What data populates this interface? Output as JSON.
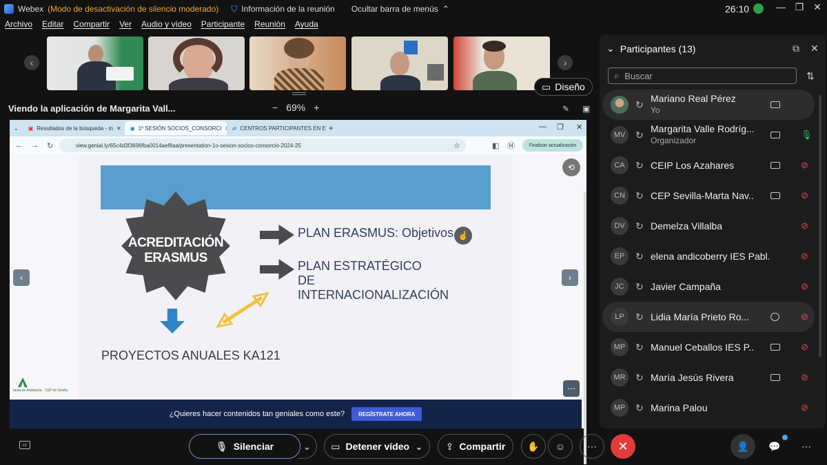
{
  "titlebar": {
    "app_name": "Webex",
    "mode": "(Modo de desactivación de silencio moderado)",
    "meeting_info": "Información de la reunión",
    "hide_menu": "Ocultar barra de menús",
    "timer": "26:10"
  },
  "menu": [
    "Archivo",
    "Editar",
    "Compartir",
    "Ver",
    "Audio y vídeo",
    "Participante",
    "Reunión",
    "Ayuda"
  ],
  "layout_button": "Diseño",
  "share": {
    "title": "Viendo la aplicación de Margarita Vall...",
    "zoom": "69%"
  },
  "browser": {
    "tabs": [
      "Resultados de la búsqueda - m",
      "1º SESIÓN SOCIOS_CONSORCI",
      "CENTROS PARTICIPANTES EN E"
    ],
    "url": "view.genial.ly/65c4d3f3696fba0014aef8aa/presentation-1o-sesion-socios-consorcio-2024-25",
    "finish_update": "Finalizar actualización"
  },
  "slide": {
    "badge": "ACREDITACIÓN ERASMUS",
    "item1": "PLAN ERASMUS: Objetivos",
    "item2": "PLAN ESTRATÉGICO DE INTERNACIONALIZACIÓN",
    "bottom": "PROYECTOS ANUALES KA121",
    "logo_text": "Junta de Andalucía · CEP de Sevilla"
  },
  "banner": {
    "text": "¿Quieres hacer contenidos tan geniales como este?",
    "button": "REGÍSTRATE AHORA"
  },
  "panel": {
    "title": "Participantes (13)",
    "search_placeholder": "Buscar",
    "participants": [
      {
        "initials": "",
        "name": "Mariano Real Pérez",
        "role": "Yo",
        "device": "camera",
        "mic": "none"
      },
      {
        "initials": "MV",
        "name": "Margarita Valle Rodríg...",
        "role": "Organizador",
        "device": "camera",
        "mic": "on"
      },
      {
        "initials": "CA",
        "name": "CEIP Los Azahares",
        "role": "",
        "device": "camera",
        "mic": "muted"
      },
      {
        "initials": "CN",
        "name": "CEP Sevilla-Marta Nav...",
        "role": "",
        "device": "camera",
        "mic": "muted"
      },
      {
        "initials": "DV",
        "name": "Demelza Villalba",
        "role": "",
        "device": "",
        "mic": "muted"
      },
      {
        "initials": "EP",
        "name": "elena andicoberry IES Pabl...",
        "role": "",
        "device": "",
        "mic": "muted"
      },
      {
        "initials": "JC",
        "name": "Javier Campaña",
        "role": "",
        "device": "",
        "mic": "muted"
      },
      {
        "initials": "LP",
        "name": "Lidia María Prieto Ro...",
        "role": "",
        "device": "chat",
        "mic": "muted"
      },
      {
        "initials": "MP",
        "name": "Manuel Ceballos IES P...",
        "role": "",
        "device": "camera",
        "mic": "muted"
      },
      {
        "initials": "MR",
        "name": "María Jesús Rivera",
        "role": "",
        "device": "camera",
        "mic": "muted"
      },
      {
        "initials": "MP",
        "name": "Marina Palou",
        "role": "",
        "device": "",
        "mic": "muted"
      }
    ]
  },
  "controls": {
    "mute": "Silenciar",
    "stop_video": "Detener vídeo",
    "share": "Compartir"
  }
}
